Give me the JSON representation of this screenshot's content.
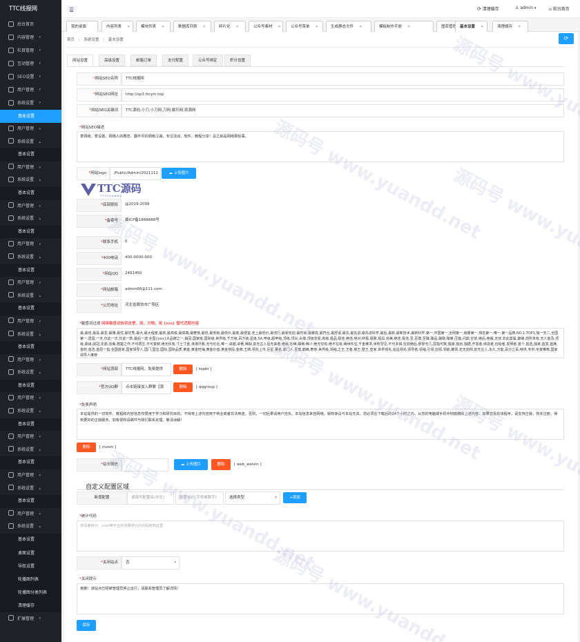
{
  "app": {
    "title": "TTC线报网"
  },
  "header": {
    "clear_cache": "清理缓存",
    "user": "admin",
    "frontend": "前台首页"
  },
  "sidebar": {
    "items": [
      {
        "label": "后台首页",
        "icon": "home-icon"
      },
      {
        "label": "内容管理",
        "icon": "content-icon"
      },
      {
        "label": "栏目管理",
        "icon": "column-icon"
      },
      {
        "label": "互动管理",
        "icon": "interact-icon"
      },
      {
        "label": "SEO设置",
        "icon": "seo-icon"
      },
      {
        "label": "用户管理",
        "icon": "user-icon"
      },
      {
        "label": "系统设置",
        "icon": "gear-icon"
      }
    ],
    "sub_basic": "基本设置",
    "repeat_a": "用户管理",
    "repeat_b": "系统设置",
    "bottom_items": [
      "桌面设置",
      "导航设置",
      "轮播图列表",
      "轮播图分类列表",
      "清理缓存"
    ],
    "expand": "扩展管理"
  },
  "tabs": [
    {
      "label": "我的桌面"
    },
    {
      "label": "内容列表"
    },
    {
      "label": "模块列表"
    },
    {
      "label": "数据库列表"
    },
    {
      "label": "碎片化"
    },
    {
      "label": "公众号素材"
    },
    {
      "label": "公众号菜单"
    },
    {
      "label": "生成静态文件"
    },
    {
      "label": "模板制作手册"
    },
    {
      "label": "图库管理"
    },
    {
      "label": "基本设置"
    },
    {
      "label": "清理缓存"
    }
  ],
  "breadcrumb": {
    "home": "首页",
    "level1": "系统设置",
    "level2": "基本设置"
  },
  "subtabs": [
    "网站设置",
    "高级设置",
    "邮箱订单",
    "支付配置",
    "公众号绑定",
    "积分设置"
  ],
  "form": {
    "site_name": {
      "label": "网站SEO名称",
      "value": "TTC线报网"
    },
    "site_url": {
      "label": "网站SEO网址",
      "value": "http://sp3.ttcym.top"
    },
    "site_keywords": {
      "label": "网站SEO关键词",
      "value": "TTC源码,小刀,小刀网,刀网,娱乐网,资源网"
    },
    "site_desc": {
      "label": "网站SEO描述",
      "value": "爱网络，爱设置。网络人的概念，翻不尽的网络江湖。专注活动、软件、教程分享！总之就是网络那些事。"
    },
    "logo": {
      "label": "网站logo",
      "value": "/Public/Admin/2021112",
      "upload": "上传图片",
      "brand": "TTC源码",
      "brand_sub": "T T C Y U A N M A"
    },
    "copyright": {
      "label": "底部版权",
      "value": "@2019-2099"
    },
    "icp": {
      "label": "备案号",
      "value": "冀ICP备1888888号"
    },
    "phone": {
      "label": "联系手机",
      "value": "0"
    },
    "tel400": {
      "label": "400电话",
      "value": "400-0000-000"
    },
    "qq": {
      "label": "网站QQ",
      "value": "2491450"
    },
    "email": {
      "label": "网站邮箱",
      "value": "admin66@111.com"
    },
    "address": {
      "label": "公司地址",
      "value": "河北省廊坊市广阳区"
    },
    "filter": {
      "label": "敏感词过滤",
      "hint": "网络敏感词放到这里，用，分隔，用 {xxx} 替代违配内容",
      "value": "最,最佳,最具,最爱,最赚,最优,最优秀,最大,最大程度,最高,最高级,最高端,最奢侈,最低,最低级,最低价,最底,最便宜,史上最低价,最流行,最受欢迎,最时尚,最聚拢,最符合,最舒适,最先,最先进,最先进科学,最后,最新,最新技术,最新科学,第一,中国第一,全网第一,销量第一,排名第一,唯一,第一品牌,NO.1,TOP1,独一无二,全国第一,遗留,一天,仅此一次,仅此一款,最后一波,全国{xxx}大品牌之一,销冠,国家级,国际级,世界级,千万级,百万级,星级,5A,甲级,超甲级,顶级,顶尖,尖端,顶级享受,高级,极品,极佳,绝佳,绝对,终极,极致,极具,完美,绝佳,极佳,至,至尊,至臻,臻品,臻致,臻席,压轴,问鼎,空前,绝后,绝版,无双,非此莫属,巅峰,前所未有,无人能及,顶级,鼎级,鼎冠,定鼎,完美,翘楚之作,不可再生,不可复制,绝无仅有,寸土寸金,淋漓尽致,无与伦比,唯一,卓越,卓著,稀缺,前无古人后无来者,绝版,珍稀,臻稀,稀少,绝无仅有,绝不在有,稀世珍宝,千金难求,世所罕见,不可多得,空前绝后,寥寥无几,屈指可数,独家,独创,独据,开发者,缔造者,创始者,发明者,首个,首选,独家,首发,首席,首府,首选,首屈一指,全国首家,国家领导人,国门,国宝,国际,国际品质,黄金,黄金旺铺,黄金价值,黄金地段,金牌,王牌,领先上市,巨星,著名,掌门人,至尊,巅峰,奢侈,世界级,领袖,之王,王者,楼王,墅王,皇家,世界领先,遥遥领先,领导者,领袖,引领,创领,领航,耀领,史无前例,前无古人,永久,万能,百分之百,特供,专供,专家推荐,国家领导人推荐"
    },
    "top": {
      "label": "网站顶部",
      "value": "TTC线报网，免费提供",
      "del": "删除",
      "tag": "[ topbt ]"
    },
    "qqgroup": {
      "label": "官方QQ群",
      "value": "点击链接加入群聊【源",
      "del": "删除",
      "tag": "[ qqgroup ]"
    },
    "disclaimer": {
      "label": "免责声明",
      "value": "本站提供的一切软件、教程和内容信息仅限用于学习和研究目的；不得将上述内容用于商业或者非法用途，否则，一切后果请用户自负。本站信息来自网络，版权争议与本站无关。您必须在下载后的24个小时之内，从您的电脑或手机中彻底删除上述内容。如果您喜欢该程序，请支持正版，购买注册，得到更好的正版服务。如有侵权请邮件与我们联系处理。敬请谅解！",
      "del": "删除",
      "tag": "[ mzsm ]"
    },
    "wechat": {
      "label": "站长微信",
      "upload": "上传图片",
      "del": "删除",
      "tag": "[ web_weixin ]"
    },
    "custom": {
      "title": "自定义配置区域",
      "label": "新增配置",
      "name_ph": "请填写配置名(中文)",
      "key_ph": "配置标识(字母或数字)",
      "type": "选择类型",
      "add": "+添加"
    },
    "stats": {
      "label": "统计代码",
      "placeholder": "将百度统计、cnzz等平台的流量统计JS代码放到这里"
    },
    "close_site": {
      "label": "关闭站点",
      "value": "否"
    },
    "close_tip": {
      "label": "关闭提示",
      "value": "抱歉！该站点已经被管理员停止运行，请联系管理员了解详情！"
    },
    "save": "保存"
  },
  "watermark": "源码号 www.yuandd.net"
}
